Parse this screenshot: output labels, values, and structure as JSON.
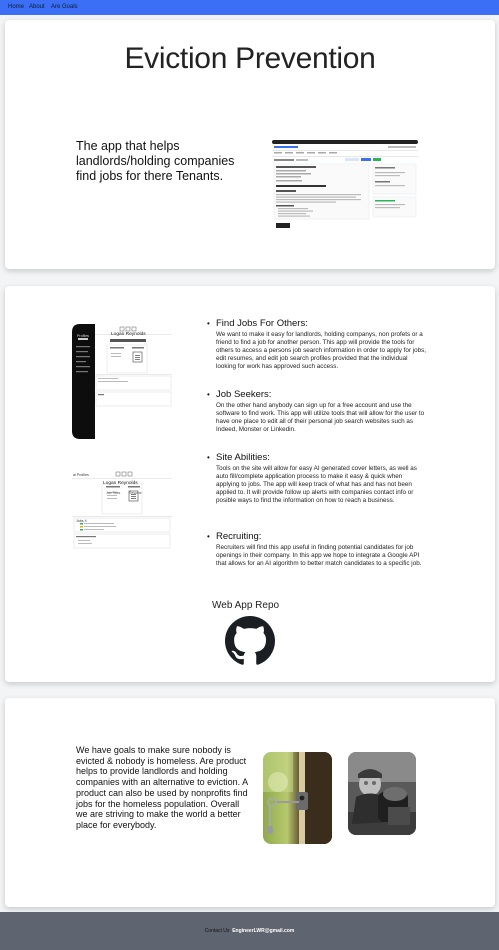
{
  "nav": {
    "items": [
      "Home",
      "About",
      "Are Goals"
    ]
  },
  "hero": {
    "title": "Eviction Prevention",
    "tagline": "The app that helps landlords/holding companies find jobs for there Tenants."
  },
  "features": [
    {
      "title": "Find Jobs For Others:",
      "body": "We want to make it easy for landlords, holding companys, non profets or a friend to find a job for another person. This app will provide the tools for others to access a persons job search information in order to apply for jobs, edit resumes, and edit job search profiles provided that the individual looking for work has approved such access."
    },
    {
      "title": "Job Seekers:",
      "body": "On the other hand anybody can sign up for a free account and use the software to find work. This app will utilize tools that will allow for the user to have one place to edit all of their personal job search websites such as Indeed, Monster or Linkedin."
    },
    {
      "title": "Site Abilities:",
      "body": "Tools on the site will allow for easy AI generated cover letters, as well as auto fill/complete application process to make it easy & quick when applying to jobs. The app will keep track of what has and has not been applied to. It will provide follow up alerts with companies contact info or posible ways to find the information on how to reach a business."
    },
    {
      "title": "Recruiting:",
      "body": "Recruiters will find this app useful in finding potential candidates for job openings in their company. In this app we hope to integrate a Google API that allows for an AI algorithm to better match candidates to a specific job."
    }
  ],
  "mockup": {
    "name": "Logan Reynolds",
    "col1": "Job Titles",
    "col2": "Resume",
    "sidebar_title": "Profiles",
    "jobs_label": "Jobs 4",
    "partial_label": "al Profiles"
  },
  "repo": {
    "label": "Web App Repo",
    "icon": "github-icon"
  },
  "goals": {
    "text": "We have goals to make sure nobody is evicted & nobody is homeless. Are product helps to provide landlords and holding companies with an alternative to eviction. A product can also be used by nonprofits find jobs for the homeless population. Overall we are striving to make the world a better place for everybody."
  },
  "footer": {
    "label": "Contact Us:",
    "email": "EngineerLWR@gmail.com"
  },
  "colors": {
    "nav": "#3b6ff5",
    "footer": "#5f6570",
    "background": "#f3f4f6"
  }
}
